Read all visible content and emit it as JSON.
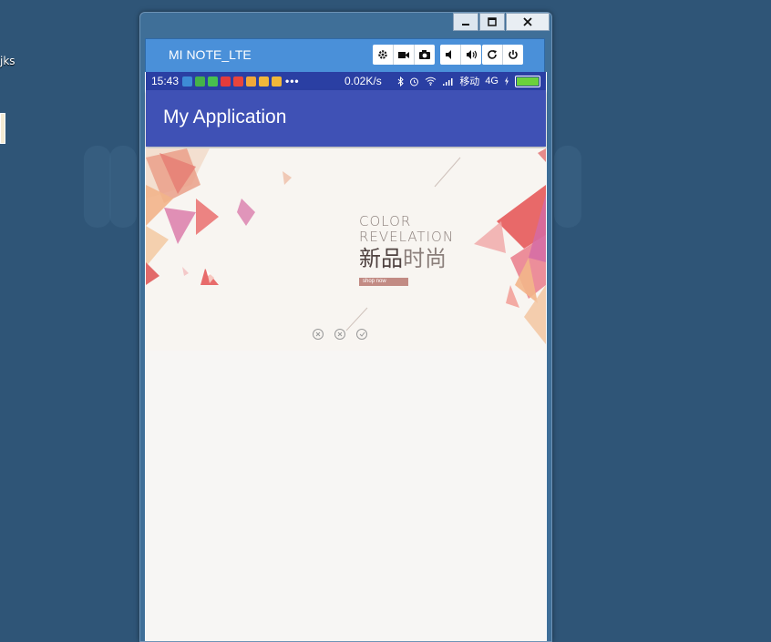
{
  "desktop": {
    "label": "jks"
  },
  "window": {
    "minimize_icon": "minimize-icon",
    "maximize_icon": "maximize-icon",
    "close_icon": "close-icon"
  },
  "emulator": {
    "device_name": "MI NOTE_LTE",
    "tools": [
      "gear-icon",
      "video-camera-icon",
      "camera-icon",
      "volume-down-icon",
      "volume-up-icon",
      "rotate-icon",
      "power-icon"
    ]
  },
  "statusbar": {
    "time": "15:43",
    "more": "•••",
    "speed": "0.02K/s",
    "carrier": "移动",
    "network": "4G",
    "battery_level": 1.0,
    "notification_colors": [
      "#3d8bd6",
      "#45b24a",
      "#47c14f",
      "#e33b3b",
      "#e8453c",
      "#f0a83a",
      "#f0b73a",
      "#f0b73a"
    ]
  },
  "appbar": {
    "title": "My Application"
  },
  "banner": {
    "line1": "COLOR",
    "line2": "REVELATION",
    "cn_bold": "新品",
    "cn_light": "时尚",
    "button": "shop now"
  },
  "indicators": [
    "close-circle-icon",
    "close-circle-icon",
    "check-circle-icon"
  ],
  "colors": {
    "desktop": "#2f5577",
    "emulator_bar": "#4a90d9",
    "statusbar": "#2a3fa3",
    "appbar": "#3f51b5",
    "content_bg": "#f7f6f4"
  }
}
